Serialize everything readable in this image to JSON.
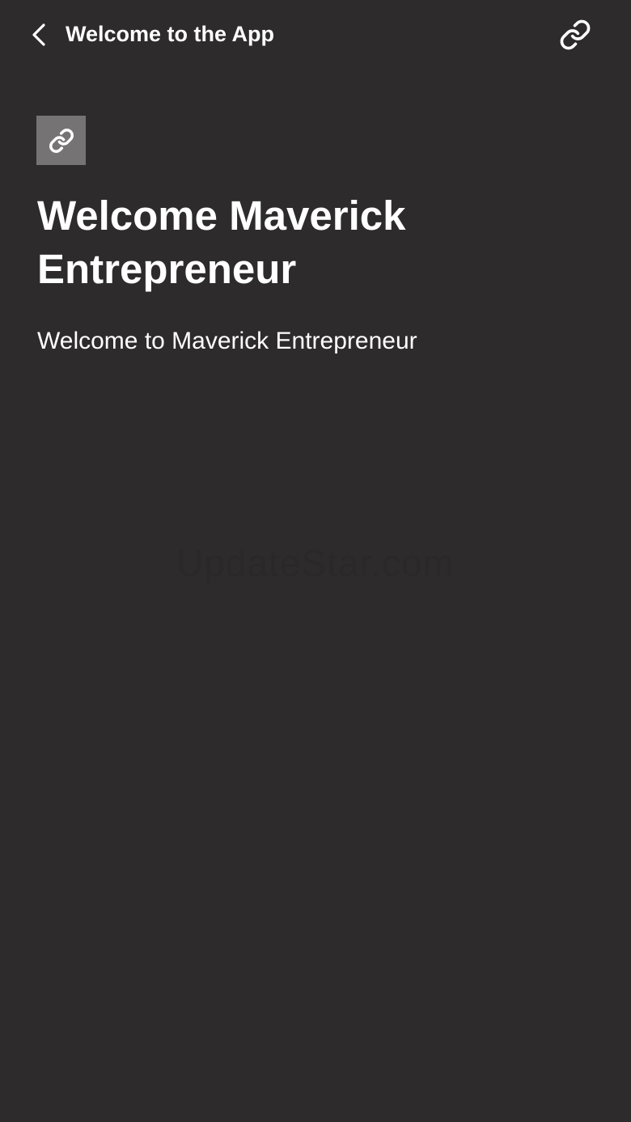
{
  "header": {
    "title": "Welcome to the App",
    "back_icon": "chevron-left-icon",
    "share_icon": "link-icon"
  },
  "content": {
    "thumbnail_icon": "link-icon",
    "headline": "Welcome Maverick Entrepreneur",
    "description": "Welcome to Maverick Entrepreneur"
  },
  "watermark": "UpdateStar.com",
  "colors": {
    "background": "#2d2b2c",
    "thumbnail_bg": "#757374",
    "text": "#ffffff"
  }
}
